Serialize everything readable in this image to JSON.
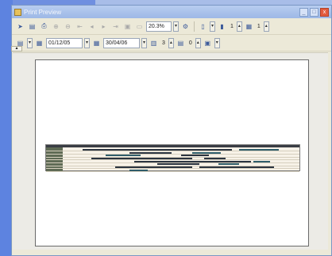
{
  "window": {
    "title": "Print Preview"
  },
  "toolbar1": {
    "zoom": "20.3%",
    "page_value": "1",
    "pages_value": "1"
  },
  "toolbar2": {
    "start_date": "01/12/05",
    "end_date": "30/04/06",
    "spin1_value": "3",
    "spin2_value": "0"
  },
  "colors": {
    "accent": "#3c5a9a",
    "grid_header": "#3a3d44",
    "bar_dark": "#2b3440",
    "bar_teal": "#2f5d6a"
  },
  "grid_rows": [
    {
      "bars": [
        {
          "start": 0.08,
          "end": 0.72,
          "color": "#2b3440"
        },
        {
          "start": 0.75,
          "end": 0.92,
          "color": "#2f5d6a"
        }
      ]
    },
    {
      "bars": [
        {
          "start": 0.28,
          "end": 0.46,
          "color": "#2b3440"
        },
        {
          "start": 0.55,
          "end": 0.67,
          "color": "#2f5d6a"
        }
      ]
    },
    {
      "bars": [
        {
          "start": 0.18,
          "end": 0.33,
          "color": "#2f5d6a"
        },
        {
          "start": 0.5,
          "end": 0.62,
          "color": "#2b3440"
        }
      ]
    },
    {
      "bars": [
        {
          "start": 0.12,
          "end": 0.55,
          "color": "#2b3440"
        },
        {
          "start": 0.6,
          "end": 0.69,
          "color": "#2b3440"
        }
      ]
    },
    {
      "bars": [
        {
          "start": 0.3,
          "end": 0.8,
          "color": "#2b3440"
        },
        {
          "start": 0.81,
          "end": 0.88,
          "color": "#2f5d6a"
        }
      ]
    },
    {
      "bars": [
        {
          "start": 0.4,
          "end": 0.58,
          "color": "#2b3440"
        },
        {
          "start": 0.66,
          "end": 0.75,
          "color": "#2f5d6a"
        }
      ]
    },
    {
      "bars": [
        {
          "start": 0.22,
          "end": 0.55,
          "color": "#2b3440"
        },
        {
          "start": 0.58,
          "end": 0.9,
          "color": "#2b3440"
        }
      ]
    },
    {
      "bars": [
        {
          "start": 0.28,
          "end": 0.36,
          "color": "#2f5d6a"
        }
      ]
    }
  ]
}
